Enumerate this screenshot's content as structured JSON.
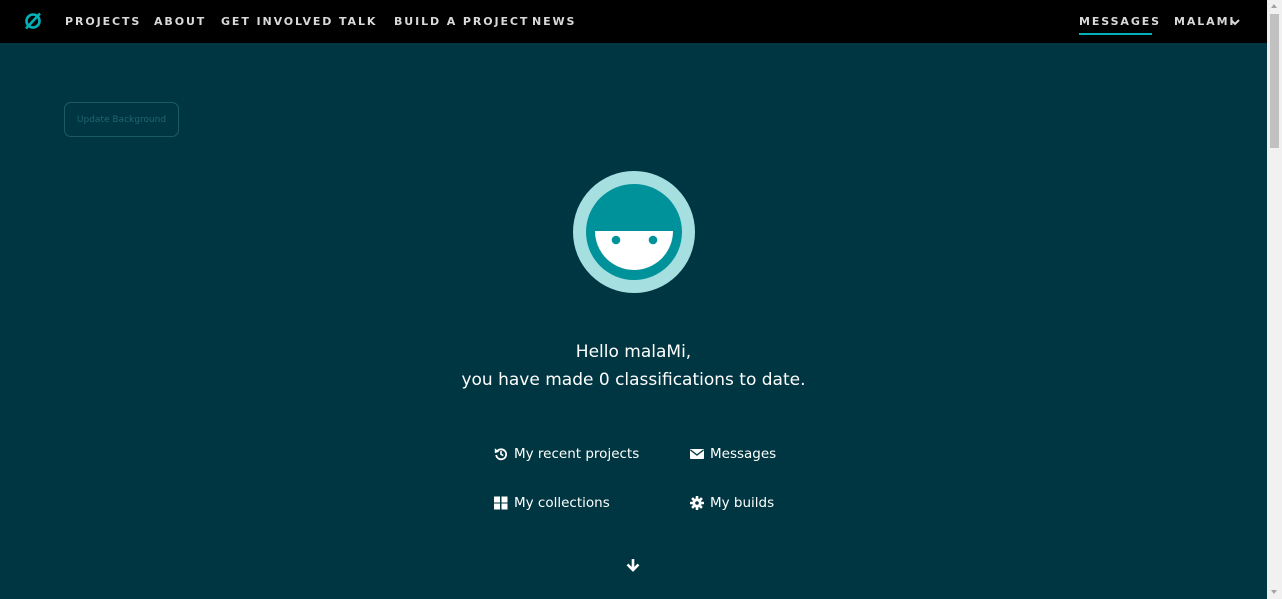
{
  "nav": {
    "logo_icon": "zooniverse-logo-icon",
    "links": [
      "PROJECTS",
      "ABOUT",
      "GET INVOLVED",
      "TALK",
      "BUILD A PROJECT",
      "NEWS"
    ],
    "messages_label": "MESSAGES",
    "user_label": "MALAMI",
    "accent_color": "#00b1b7"
  },
  "update_background_label": "Update Background",
  "greeting": {
    "line1": "Hello malaMi,",
    "line2": "you have made 0 classifications to date."
  },
  "links": {
    "recent_projects": "My recent projects",
    "messages": "Messages",
    "collections": "My collections",
    "builds": "My builds"
  },
  "colors": {
    "background": "#003641",
    "nav_background": "#000000",
    "avatar_outer": "#a6dfe0",
    "avatar_inner": "#00929b"
  }
}
